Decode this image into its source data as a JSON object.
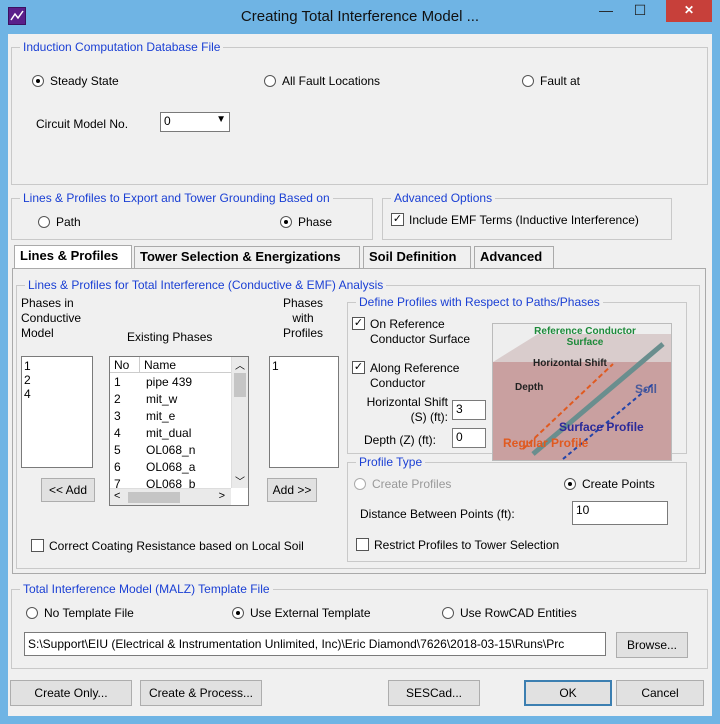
{
  "window": {
    "title": "Creating Total Interference Model ...",
    "minimize_glyph": "—",
    "maximize_glyph": "☐",
    "close_glyph": "✕"
  },
  "induction": {
    "legend": "Induction Computation Database File",
    "steady_state": "Steady State",
    "all_fault": "All Fault Locations",
    "fault_at": "Fault at",
    "circuit_label": "Circuit Model No.",
    "circuit_value": "0",
    "selected": "steady_state"
  },
  "lines_export": {
    "legend": "Lines & Profiles to Export and Tower Grounding Based on",
    "path": "Path",
    "phase": "Phase",
    "selected": "phase"
  },
  "advanced": {
    "legend": "Advanced Options",
    "include_emf": "Include EMF Terms  (Inductive Interference)",
    "include_emf_checked": true
  },
  "tabs": [
    {
      "label": "Lines & Profiles",
      "active": true
    },
    {
      "label": "Tower Selection & Energizations",
      "active": false
    },
    {
      "label": "Soil Definition",
      "active": false
    },
    {
      "label": "Advanced",
      "active": false
    }
  ],
  "lp": {
    "legend": "Lines & Profiles for Total Interference (Conductive & EMF) Analysis",
    "phases_cond_label": "Phases in Conductive Model",
    "phases_cond": [
      "1",
      "2",
      "4"
    ],
    "existing_label": "Existing Phases",
    "grid_headers": [
      "No",
      "Name"
    ],
    "existing": [
      {
        "no": "1",
        "name": "pipe 439"
      },
      {
        "no": "2",
        "name": "mit_w"
      },
      {
        "no": "3",
        "name": "mit_e"
      },
      {
        "no": "4",
        "name": "mit_dual"
      },
      {
        "no": "5",
        "name": "OL068_n"
      },
      {
        "no": "6",
        "name": "OL068_a"
      },
      {
        "no": "7",
        "name": "OL068_b"
      }
    ],
    "phases_prof_label": "Phases with Profiles",
    "phases_prof": [
      "1"
    ],
    "add_left": "<< Add",
    "add_right": "Add >>",
    "correct_coating": "Correct Coating Resistance based on Local Soil",
    "define_legend": "Define Profiles with Respect to Paths/Phases",
    "on_ref": "On Reference Conductor Surface",
    "on_ref_checked": true,
    "along_ref": "Along Reference Conductor",
    "along_ref_checked": true,
    "hshift_label": "Horizontal Shift (S) (ft):",
    "hshift_value": "3",
    "depth_label": "Depth (Z) (ft):",
    "depth_value": "0",
    "diagram": {
      "ref_cond": "Reference Conductor Surface",
      "hshift": "Horizontal Shift",
      "depth": "Depth",
      "soil": "Soil",
      "surface_profile": "Surface Profile",
      "regular_profile": "Regular Profile"
    },
    "profile_type_legend": "Profile Type",
    "create_profiles": "Create Profiles",
    "create_points": "Create Points",
    "distance_label": "Distance Between Points (ft):",
    "distance_value": "10",
    "restrict": "Restrict Profiles to Tower Selection"
  },
  "template": {
    "legend": "Total Interference Model (MALZ) Template File",
    "no_template": "No Template File",
    "use_external": "Use External Template",
    "use_rowcad": "Use RowCAD Entities",
    "selected": "use_external",
    "path": "S:\\Support\\EIU (Electrical & Instrumentation Unlimited, Inc)\\Eric Diamond\\7626\\2018-03-15\\Runs\\Prc",
    "browse": "Browse..."
  },
  "footer": {
    "create_only": "Create Only...",
    "create_process": "Create & Process...",
    "sescad": "SESCad...",
    "ok": "OK",
    "cancel": "Cancel"
  }
}
